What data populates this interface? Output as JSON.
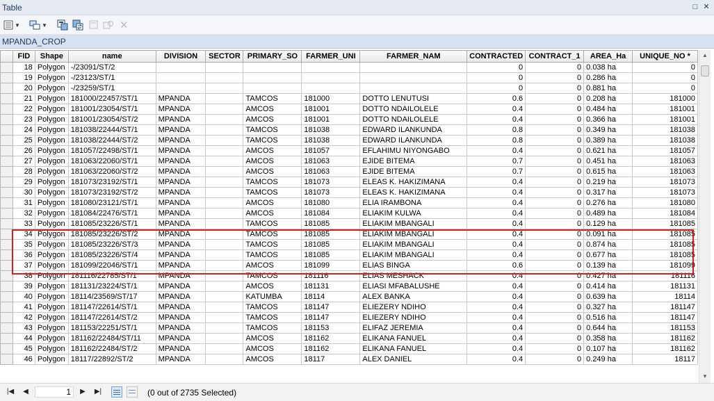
{
  "window": {
    "title": "Table",
    "restore_glyph": "□",
    "close_glyph": "✕"
  },
  "toolbar": {
    "icons": [
      "table-options-icon",
      "related-tables-icon",
      "select-by-attributes-icon",
      "switch-selection-icon",
      "clear-selection-icon",
      "zoom-to-selected-icon",
      "delete-selected-icon"
    ]
  },
  "tab": {
    "name": "MPANDA_CROP"
  },
  "table": {
    "columns": [
      "FID",
      "Shape",
      "name",
      "DIVISION",
      "SECTOR",
      "PRIMARY_SO",
      "FARMER_UNI",
      "FARMER_NAM",
      "CONTRACTED",
      "CONTRACT_1",
      "AREA_Ha",
      "UNIQUE_NO *"
    ],
    "rows": [
      [
        "18",
        "Polygon",
        "-/23091/ST/2",
        "",
        "",
        "",
        "",
        "",
        "0",
        "0",
        "0.038 ha",
        "0"
      ],
      [
        "19",
        "Polygon",
        "-/23123/ST/1",
        "",
        "",
        "",
        "",
        "",
        "0",
        "0",
        "0.286 ha",
        "0"
      ],
      [
        "20",
        "Polygon",
        "-/23259/ST/1",
        "",
        "",
        "",
        "",
        "",
        "0",
        "0",
        "0.881 ha",
        "0"
      ],
      [
        "21",
        "Polygon",
        "181000/22457/ST/1",
        "MPANDA",
        "",
        "TAMCOS",
        "181000",
        "DOTTO LENUTUSI",
        "0.6",
        "0",
        "0.208 ha",
        "181000"
      ],
      [
        "22",
        "Polygon",
        "181001/23054/ST/1",
        "MPANDA",
        "",
        "AMCOS",
        "181001",
        "DOTTO NDAILOLELE",
        "0.4",
        "0",
        "0.484 ha",
        "181001"
      ],
      [
        "23",
        "Polygon",
        "181001/23054/ST/2",
        "MPANDA",
        "",
        "AMCOS",
        "181001",
        "DOTTO NDAILOLELE",
        "0.4",
        "0",
        "0.366 ha",
        "181001"
      ],
      [
        "24",
        "Polygon",
        "181038/22444/ST/1",
        "MPANDA",
        "",
        "TAMCOS",
        "181038",
        "EDWARD ILANKUNDA",
        "0.8",
        "0",
        "0.349 ha",
        "181038"
      ],
      [
        "25",
        "Polygon",
        "181038/22444/ST/2",
        "MPANDA",
        "",
        "TAMCOS",
        "181038",
        "EDWARD ILANKUNDA",
        "0.8",
        "0",
        "0.389 ha",
        "181038"
      ],
      [
        "26",
        "Polygon",
        "181057/22498/ST/1",
        "MPANDA",
        "",
        "AMCOS",
        "181057",
        "EFLAHIMU NIYONGABO",
        "0.4",
        "0",
        "0.621 ha",
        "181057"
      ],
      [
        "27",
        "Polygon",
        "181063/22060/ST/1",
        "MPANDA",
        "",
        "AMCOS",
        "181063",
        "EJIDE BITEMA",
        "0.7",
        "0",
        "0.451 ha",
        "181063"
      ],
      [
        "28",
        "Polygon",
        "181063/22060/ST/2",
        "MPANDA",
        "",
        "AMCOS",
        "181063",
        "EJIDE BITEMA",
        "0.7",
        "0",
        "0.615 ha",
        "181063"
      ],
      [
        "29",
        "Polygon",
        "181073/23192/ST/1",
        "MPANDA",
        "",
        "TAMCOS",
        "181073",
        "ELEAS K. HAKIZIMANA",
        "0.4",
        "0",
        "0.219 ha",
        "181073"
      ],
      [
        "30",
        "Polygon",
        "181073/23192/ST/2",
        "MPANDA",
        "",
        "TAMCOS",
        "181073",
        "ELEAS K. HAKIZIMANA",
        "0.4",
        "0",
        "0.317 ha",
        "181073"
      ],
      [
        "31",
        "Polygon",
        "181080/23121/ST/1",
        "MPANDA",
        "",
        "AMCOS",
        "181080",
        "ELIA IRAMBONA",
        "0.4",
        "0",
        "0.276 ha",
        "181080"
      ],
      [
        "32",
        "Polygon",
        "181084/22476/ST/1",
        "MPANDA",
        "",
        "AMCOS",
        "181084",
        "ELIAKIM KULWA",
        "0.4",
        "0",
        "0.489 ha",
        "181084"
      ],
      [
        "33",
        "Polygon",
        "181085/23226/ST/1",
        "MPANDA",
        "",
        "TAMCOS",
        "181085",
        "ELIAKIM MBANGALI",
        "0.4",
        "0",
        "0.129 ha",
        "181085"
      ],
      [
        "34",
        "Polygon",
        "181085/23226/ST/2",
        "MPANDA",
        "",
        "TAMCOS",
        "181085",
        "ELIAKIM MBANGALI",
        "0.4",
        "0",
        "0.091 ha",
        "181085"
      ],
      [
        "35",
        "Polygon",
        "181085/23226/ST/3",
        "MPANDA",
        "",
        "TAMCOS",
        "181085",
        "ELIAKIM MBANGALI",
        "0.4",
        "0",
        "0.874 ha",
        "181085"
      ],
      [
        "36",
        "Polygon",
        "181085/23226/ST/4",
        "MPANDA",
        "",
        "TAMCOS",
        "181085",
        "ELIAKIM MBANGALI",
        "0.4",
        "0",
        "0.677 ha",
        "181085"
      ],
      [
        "37",
        "Polygon",
        "181099/22046/ST/1",
        "MPANDA",
        "",
        "AMCOS",
        "181099",
        "ELIAS BINGA",
        "0.6",
        "0",
        "0.139 ha",
        "181099"
      ],
      [
        "38",
        "Polygon",
        "181116/22785/ST/1",
        "MPANDA",
        "",
        "TAMCOS",
        "181116",
        "ELIAS MESHACK",
        "0.4",
        "0",
        "0.427 ha",
        "181116"
      ],
      [
        "39",
        "Polygon",
        "181131/23224/ST/1",
        "MPANDA",
        "",
        "AMCOS",
        "181131",
        "ELIASI MFABALUSHE",
        "0.4",
        "0",
        "0.414 ha",
        "181131"
      ],
      [
        "40",
        "Polygon",
        "18114/23569/ST/17",
        "MPANDA",
        "",
        "KATUMBA",
        "18114",
        "ALEX BANKA",
        "0.4",
        "0",
        "0.639 ha",
        "18114"
      ],
      [
        "41",
        "Polygon",
        "181147/22614/ST/1",
        "MPANDA",
        "",
        "TAMCOS",
        "181147",
        "ELIEZERY NDIHO",
        "0.4",
        "0",
        "0.327 ha",
        "181147"
      ],
      [
        "42",
        "Polygon",
        "181147/22614/ST/2",
        "MPANDA",
        "",
        "TAMCOS",
        "181147",
        "ELIEZERY NDIHO",
        "0.4",
        "0",
        "0.516 ha",
        "181147"
      ],
      [
        "43",
        "Polygon",
        "181153/22251/ST/1",
        "MPANDA",
        "",
        "TAMCOS",
        "181153",
        "ELIFAZ JEREMIA",
        "0.4",
        "0",
        "0.644 ha",
        "181153"
      ],
      [
        "44",
        "Polygon",
        "181162/22484/ST/11",
        "MPANDA",
        "",
        "AMCOS",
        "181162",
        "ELIKANA FANUEL",
        "0.4",
        "0",
        "0.358 ha",
        "181162"
      ],
      [
        "45",
        "Polygon",
        "181162/22484/ST/2",
        "MPANDA",
        "",
        "AMCOS",
        "181162",
        "ELIKANA FANUEL",
        "0.4",
        "0",
        "0.107 ha",
        "181162"
      ],
      [
        "46",
        "Polygon",
        "18117/22892/ST/2",
        "MPANDA",
        "",
        "AMCOS",
        "18117",
        "ALEX DANIEL",
        "0.4",
        "0",
        "0.249 ha",
        "18117"
      ]
    ]
  },
  "status": {
    "page_value": "1",
    "selection_text": "(0 out of 2735 Selected)",
    "first_glyph": "|◀",
    "prev_glyph": "◀",
    "next_glyph": "▶",
    "last_glyph": "▶|"
  },
  "colors": {
    "highlight_border": "#d21f26",
    "tab_background": "#d7e2f0"
  }
}
